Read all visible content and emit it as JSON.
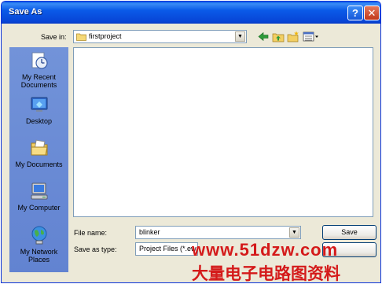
{
  "window": {
    "title": "Save As",
    "help_glyph": "?",
    "close_glyph": "✕"
  },
  "save_in": {
    "label": "Save in:",
    "folder": "firstproject"
  },
  "toolbar": {
    "icons": [
      "back-icon",
      "up-folder-icon",
      "new-folder-icon",
      "view-menu-icon"
    ]
  },
  "places": [
    {
      "label": "My Recent Documents",
      "icon": "recent-documents-icon"
    },
    {
      "label": "Desktop",
      "icon": "desktop-icon"
    },
    {
      "label": "My Documents",
      "icon": "my-documents-icon"
    },
    {
      "label": "My Computer",
      "icon": "my-computer-icon"
    },
    {
      "label": "My Network Places",
      "icon": "network-places-icon"
    }
  ],
  "file_name": {
    "label": "File name:",
    "value": "blinker"
  },
  "save_as_type": {
    "label": "Save as type:",
    "value": "Project Files (*.ew"
  },
  "buttons": {
    "save": "Save"
  },
  "watermark": {
    "url": "www.51dzw.com",
    "chinese": "大量电子电路图资料"
  },
  "colors": {
    "title_bar": "#0a5ae8",
    "dialog_bg": "#ece9d8",
    "places_bar": "#6b8cd6",
    "watermark": "#d41a1a"
  }
}
